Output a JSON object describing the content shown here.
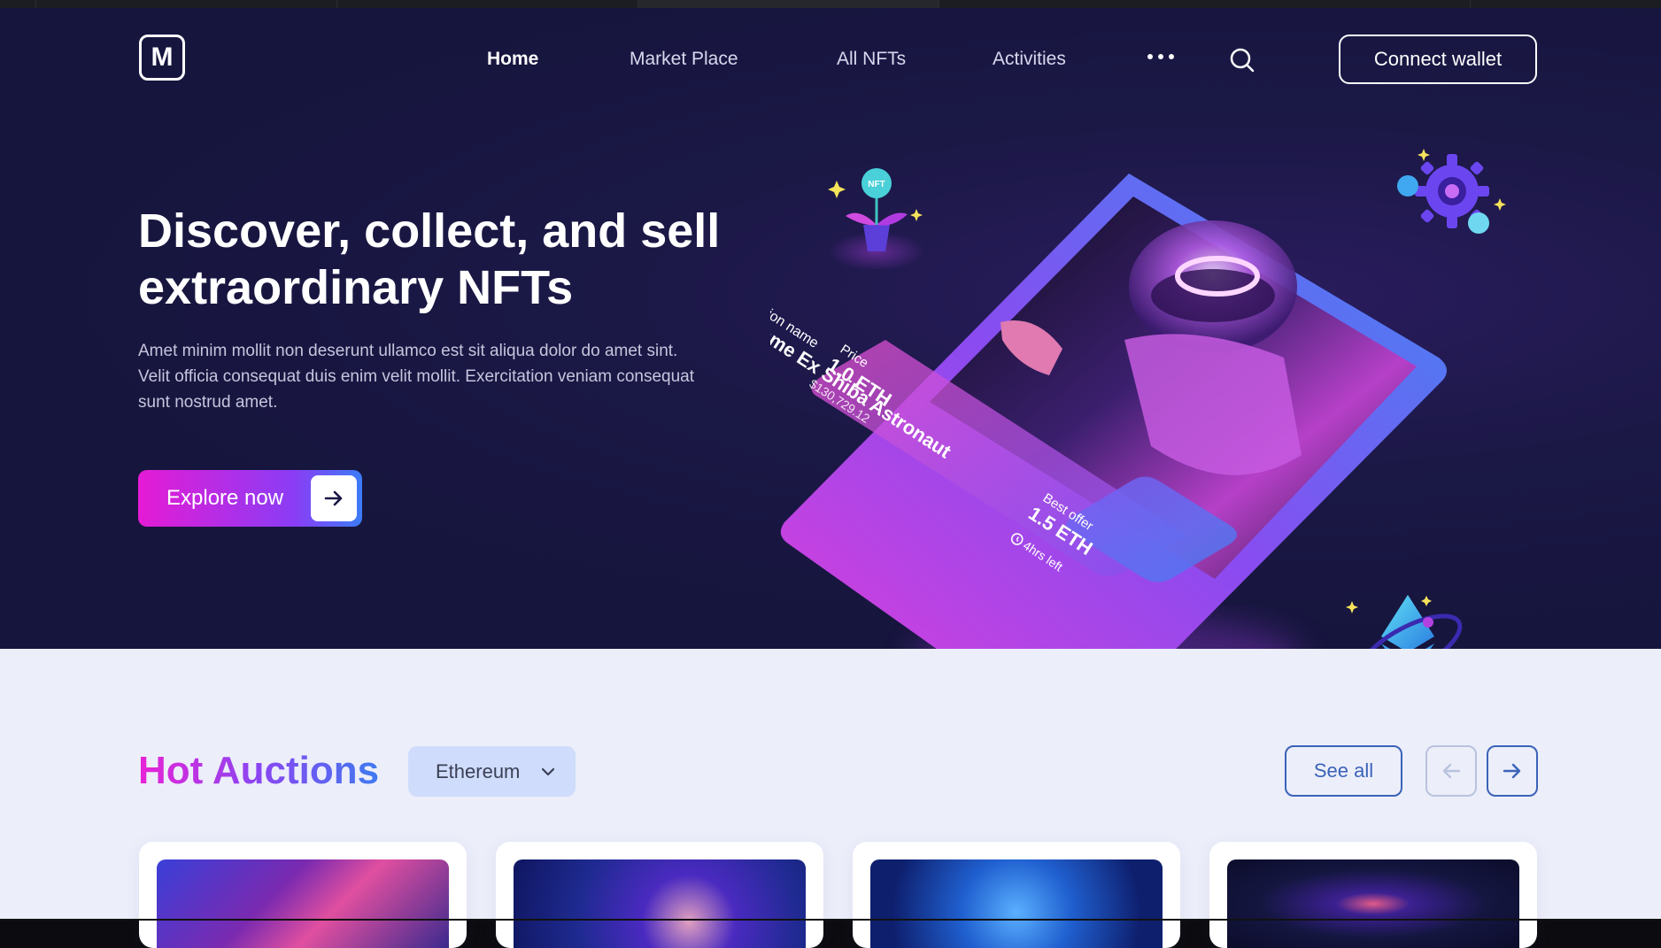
{
  "nav": {
    "logo_letter": "M",
    "links": [
      "Home",
      "Market Place",
      "All NFTs",
      "Activities"
    ],
    "more_icon": "more-dots-icon",
    "search_icon": "search-icon",
    "connect_label": "Connect wallet"
  },
  "hero": {
    "title": "Discover, collect, and sell extraordinary NFTs",
    "description": "Amet minim mollit non deserunt ullamco est sit aliqua dolor do amet sint. Velit officia consequat duis enim velit mollit. Exercitation veniam consequat sunt nostrud amet.",
    "explore_label": "Explore now"
  },
  "nft_card": {
    "collection_label": "Collection name",
    "name": "NFT name Ex Shiba Astronaut",
    "price_label": "Price",
    "price_eth": "1.0 ETH",
    "price_usd": "$130,729.12",
    "best_offer_label": "Best offer",
    "best_offer_eth": "1.5 ETH",
    "time_left": "4hrs left",
    "plant_badge": "NFT"
  },
  "auctions": {
    "title": "Hot Auctions",
    "chain_selected": "Ethereum",
    "see_all_label": "See all"
  },
  "colors": {
    "hero_bg": "#16153d",
    "accent_pink": "#e51bd5",
    "accent_purple": "#8a3df5",
    "accent_blue": "#3b7cf7",
    "lower_bg": "#eceefa"
  }
}
